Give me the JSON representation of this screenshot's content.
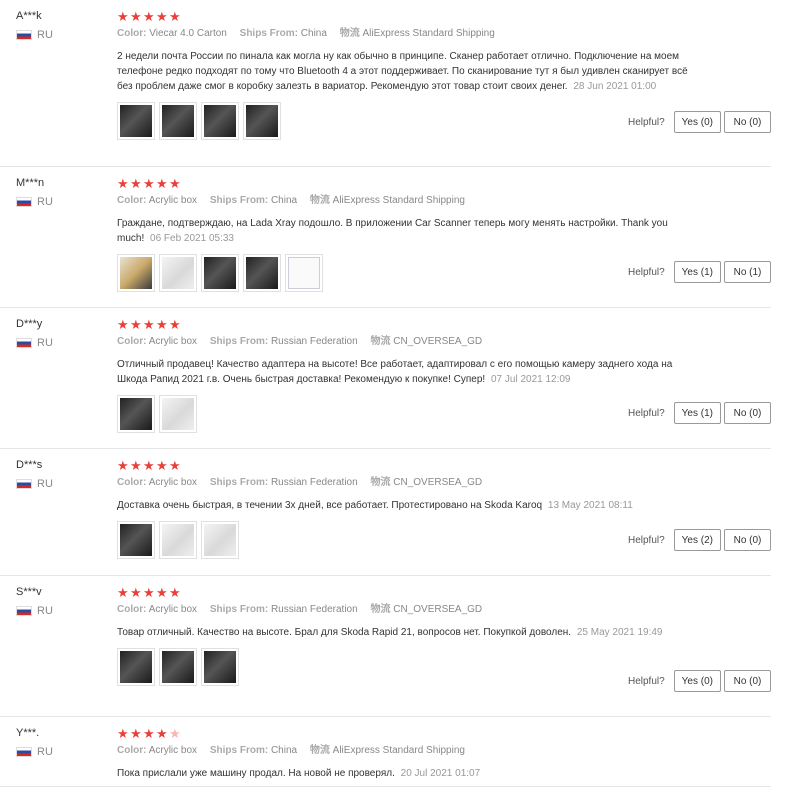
{
  "labels": {
    "color": "Color:",
    "ships_from": "Ships From:",
    "shipping_key": "物流",
    "helpful": "Helpful?"
  },
  "colors": {
    "star": "#e8413b",
    "star_partial": "#f3b7b5"
  },
  "reviews": [
    {
      "user": "A***k",
      "country": "RU",
      "rating": 5,
      "color": "Viecar 4.0 Carton",
      "ships_from": "China",
      "shipping": "AliExpress Standard Shipping",
      "text": "2 недели почта России по пинала как могла ну как обычно в принципе. Сканер работает отлично. Подключение на моем телефоне редко подходят по тому что Bluetooth 4 а этот поддерживает. По сканирование тут я был удивлен сканирует всё без проблем даже смог в коробку залезть в вариатор. Рекомендую этот товар стоит своих денег.",
      "date": "28 Jun 2021 01:00",
      "yes": "Yes (0)",
      "no": "No (0)",
      "thumbs": [
        "dark",
        "dark",
        "dark",
        "dark"
      ]
    },
    {
      "user": "M***n",
      "country": "RU",
      "rating": 5,
      "color": "Acrylic box",
      "ships_from": "China",
      "shipping": "AliExpress Standard Shipping",
      "text": "Граждане, подтверждаю, на Lada Xray подошло. В приложении Car Scanner теперь могу менять настройки. Thank you much!",
      "date": "06 Feb 2021 05:33",
      "yes": "Yes (1)",
      "no": "No (1)",
      "thumbs": [
        "warm",
        "light",
        "dark",
        "dark",
        "paper"
      ]
    },
    {
      "user": "D***y",
      "country": "RU",
      "rating": 5,
      "color": "Acrylic box",
      "ships_from": "Russian Federation",
      "shipping": "CN_OVERSEA_GD",
      "text": "Отличный продавец! Качество адаптера на высоте! Все работает, адаптировал с его помощью камеру заднего хода на Шкода Рапид 2021 г.в. Очень быстрая доставка! Рекомендую к покупке! Супер!",
      "date": "07 Jul 2021 12:09",
      "yes": "Yes (1)",
      "no": "No (0)",
      "thumbs": [
        "dark",
        "light"
      ]
    },
    {
      "user": "D***s",
      "country": "RU",
      "rating": 5,
      "color": "Acrylic box",
      "ships_from": "Russian Federation",
      "shipping": "CN_OVERSEA_GD",
      "text": "Доставка очень быстрая, в течении 3х дней, все работает. Протестировано на Skoda Karoq",
      "date": "13 May 2021 08:11",
      "yes": "Yes (2)",
      "no": "No (0)",
      "thumbs": [
        "dark",
        "light",
        "light"
      ]
    },
    {
      "user": "S***v",
      "country": "RU",
      "rating": 5,
      "color": "Acrylic box",
      "ships_from": "Russian Federation",
      "shipping": "CN_OVERSEA_GD",
      "text": "Товар отличный. Качество на высоте. Брал для Skoda Rapid 21, вопросов нет. Покупкой доволен.",
      "date": "25 May 2021 19:49",
      "yes": "Yes (0)",
      "no": "No (0)",
      "thumbs": [
        "dark",
        "dark",
        "dark"
      ]
    },
    {
      "user": "Y***.",
      "country": "RU",
      "rating": 4.8,
      "color": "Acrylic box",
      "ships_from": "China",
      "shipping": "AliExpress Standard Shipping",
      "text": "Пока прислали уже машину продал. На новой не проверял.",
      "date": "20 Jul 2021 01:07",
      "yes": "",
      "no": "",
      "thumbs": []
    }
  ]
}
